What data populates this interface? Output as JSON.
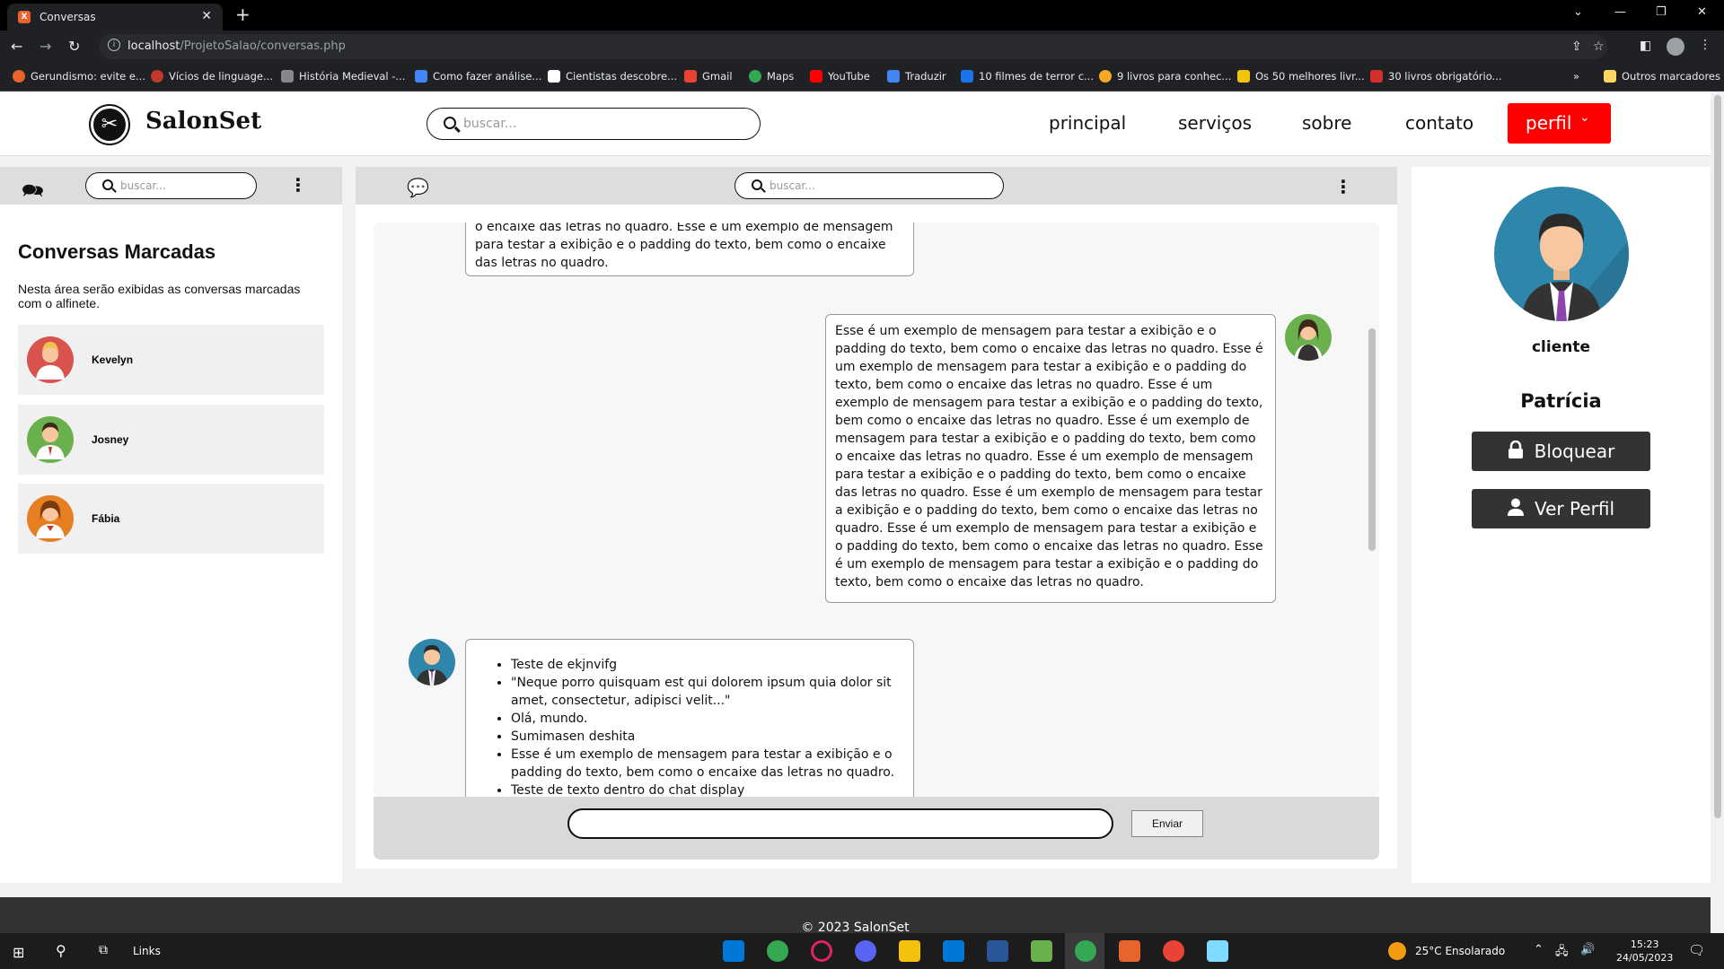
{
  "browser": {
    "tab_title": "Conversas",
    "tab_favicon": "xampp-icon",
    "url_host": "localhost",
    "url_path": "/ProjetoSalao/conversas.php",
    "bookmarks": [
      {
        "label": "Gerundismo: evite e...",
        "color": "#e8642c"
      },
      {
        "label": "Vícios de linguage...",
        "color": "#c0392b"
      },
      {
        "label": "História Medieval -...",
        "color": "#888888"
      },
      {
        "label": "Como fazer análise...",
        "color": "#4285f4"
      },
      {
        "label": "Cientistas descobre...",
        "color": "#ffffff"
      },
      {
        "label": "Gmail",
        "color": "#ea4335"
      },
      {
        "label": "Maps",
        "color": "#34a853"
      },
      {
        "label": "YouTube",
        "color": "#ff0000"
      },
      {
        "label": "Traduzir",
        "color": "#4285f4"
      },
      {
        "label": "10 filmes de terror c...",
        "color": "#1a73e8"
      },
      {
        "label": "9 livros para conhec...",
        "color": "#f9a825"
      },
      {
        "label": "Os 50 melhores livr...",
        "color": "#f4c20d"
      },
      {
        "label": "30 livros obrigatório...",
        "color": "#d32f2f"
      }
    ],
    "other_bookmarks": "Outros marcadores"
  },
  "header": {
    "brand": "SalonSet",
    "search_placeholder": "buscar...",
    "nav": [
      "principal",
      "serviços",
      "sobre",
      "contato"
    ],
    "profile_button": "perfil"
  },
  "left_panel": {
    "search_placeholder": "buscar...",
    "title": "Conversas Marcadas",
    "description": "Nesta área serão exibidas as conversas marcadas com o alfinete.",
    "conversations": [
      {
        "name": "Kevelyn",
        "avatar_color": "#d9534f"
      },
      {
        "name": "Josney",
        "avatar_color": "#6ab04c"
      },
      {
        "name": "Fábia",
        "avatar_color": "#e67e22"
      }
    ]
  },
  "chat": {
    "search_placeholder": "buscar...",
    "msg1_text": "o encaixe das letras no quadro. Esse é um exemplo de mensagem para testar a exibição e o padding do texto, bem como o encaixe das letras no quadro.",
    "msg2_text": "Esse é um exemplo de mensagem para testar a exibição e o padding do texto, bem como o encaixe das letras no quadro. Esse é um exemplo de mensagem para testar a exibição e o padding do texto, bem como o encaixe das letras no quadro. Esse é um exemplo de mensagem para testar a exibição e o padding do texto, bem como o encaixe das letras no quadro. Esse é um exemplo de mensagem para testar a exibição e o padding do texto, bem como o encaixe das letras no quadro. Esse é um exemplo de mensagem para testar a exibição e o padding do texto, bem como o encaixe das letras no quadro. Esse é um exemplo de mensagem para testar a exibição e o padding do texto, bem como o encaixe das letras no quadro. Esse é um exemplo de mensagem para testar a exibição e o padding do texto, bem como o encaixe das letras no quadro. Esse é um exemplo de mensagem para testar a exibição e o padding do texto, bem como o encaixe das letras no quadro.",
    "msg3_items": [
      "Teste de ekjnvifg",
      "\"Neque porro quisquam est qui dolorem ipsum quia dolor sit amet, consectetur, adipisci velit...\"",
      "Olá, mundo.",
      "Sumimasen deshita",
      "Esse é um exemplo de mensagem para testar a exibição e o padding do texto, bem como o encaixe das letras no quadro.",
      "Teste de texto dentro do chat display"
    ],
    "input_value": "",
    "send_label": "Enviar"
  },
  "right_panel": {
    "role": "cliente",
    "name": "Patrícia",
    "block_label": "Bloquear",
    "view_profile_label": "Ver Perfil"
  },
  "footer": {
    "copyright": "© 2023 SalonSet"
  },
  "taskbar": {
    "links_label": "Links",
    "weather": "25°C  Ensolarado",
    "time": "15:23",
    "date": "24/05/2023"
  }
}
